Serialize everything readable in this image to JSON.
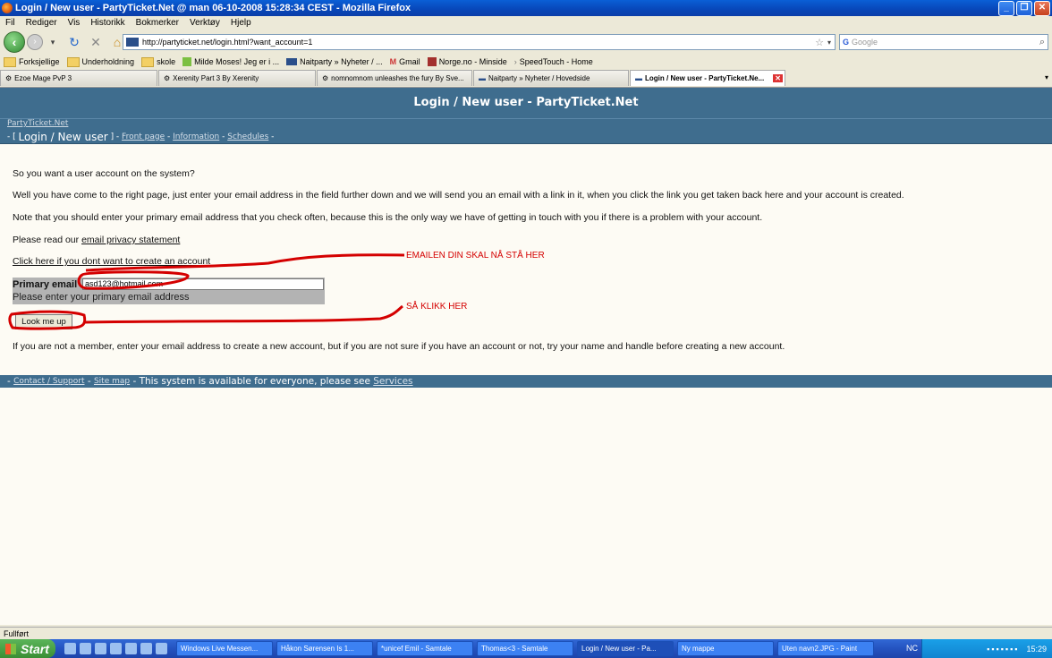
{
  "window": {
    "title": "Login / New user - PartyTicket.Net @ man 06-10-2008 15:28:34 CEST - Mozilla Firefox"
  },
  "menu": [
    "Fil",
    "Rediger",
    "Vis",
    "Historikk",
    "Bokmerker",
    "Verktøy",
    "Hjelp"
  ],
  "address": {
    "url": "http://partyticket.net/login.html?want_account=1",
    "search_placeholder": "Google"
  },
  "bookmarks": [
    {
      "label": "Forksjellige",
      "icon": "folder-icon"
    },
    {
      "label": "Underholdning",
      "icon": "folder-icon"
    },
    {
      "label": "skole",
      "icon": "folder-icon"
    },
    {
      "label": "Milde Moses! Jeg er i ...",
      "icon": "page-icon"
    },
    {
      "label": "Naitparty » Nyheter / ...",
      "icon": "page-icon"
    },
    {
      "label": "Gmail",
      "icon": "gmail-icon"
    },
    {
      "label": "Norge.no - Minside",
      "icon": "page-icon"
    },
    {
      "label": "SpeedTouch - Home",
      "icon": "page-icon"
    }
  ],
  "tabs": [
    {
      "label": "Ezoe Mage PvP 3",
      "active": false
    },
    {
      "label": "Xerenity Part 3 By Xerenity",
      "active": false
    },
    {
      "label": "nomnomnom unleashes the fury By Sve...",
      "active": false
    },
    {
      "label": "Naitparty » Nyheter / Hovedside",
      "active": false
    },
    {
      "label": "Login / New user - PartyTicket.Ne...",
      "active": true
    }
  ],
  "page": {
    "header": "Login / New user - PartyTicket.Net",
    "site_link": "PartyTicket.Net",
    "nav": {
      "prefix": "- [ ",
      "current": "Login / New user",
      "suffix": " ] - ",
      "links": [
        "Front page",
        "Information",
        "Schedules"
      ],
      "sep": " - ",
      "end": " -"
    },
    "intro": "So you want a user account on the system?",
    "para1": "Well you have come to the right page, just enter your email address in the field further down and we will send you an email with a link in it, when you click the link you get taken back here and your account is created.",
    "para2": "Note that you should enter your primary email address that you check often, because this is the only way we have of getting in touch with you if there is a problem with your account.",
    "privacy_prefix": "Please read our ",
    "privacy_link": "email privacy statement",
    "no_account_link": "Click here if you dont want to create an account",
    "email_label": "Primary email",
    "email_value": "asd123@hotmail.com",
    "email_hint": "Please enter your primary email address",
    "button_label": "Look me up",
    "member_note": "If you are not a member, enter your email address to create a new account, but if you are not sure if you have an account or not, try your name and handle before creating a new account.",
    "footer": {
      "lead": "- ",
      "contact": "Contact / Support",
      "sep": " - ",
      "sitemap": "Site map",
      "text": " - This system is available for everyone, please see ",
      "services": "Services"
    }
  },
  "annotations": {
    "email_note": "EMAILEN DIN SKAL NÅ STÅ HER",
    "click_note": "SÅ KLIKK HER",
    "color": "#d40000"
  },
  "status": "Fullført",
  "taskbar": {
    "start": "Start",
    "tasks": [
      {
        "label": "Windows Live Messen...",
        "active": false
      },
      {
        "label": "Håkon Sørensen Is 1...",
        "active": false
      },
      {
        "label": "*unicef Emil - Samtale",
        "active": false
      },
      {
        "label": "Thomas<3 - Samtale",
        "active": false
      },
      {
        "label": "Login / New user - Pa...",
        "active": true
      },
      {
        "label": "Ny mappe",
        "active": false
      },
      {
        "label": "Uten navn2.JPG - Paint",
        "active": false
      }
    ],
    "lang": "NC",
    "clock": "15:29"
  }
}
